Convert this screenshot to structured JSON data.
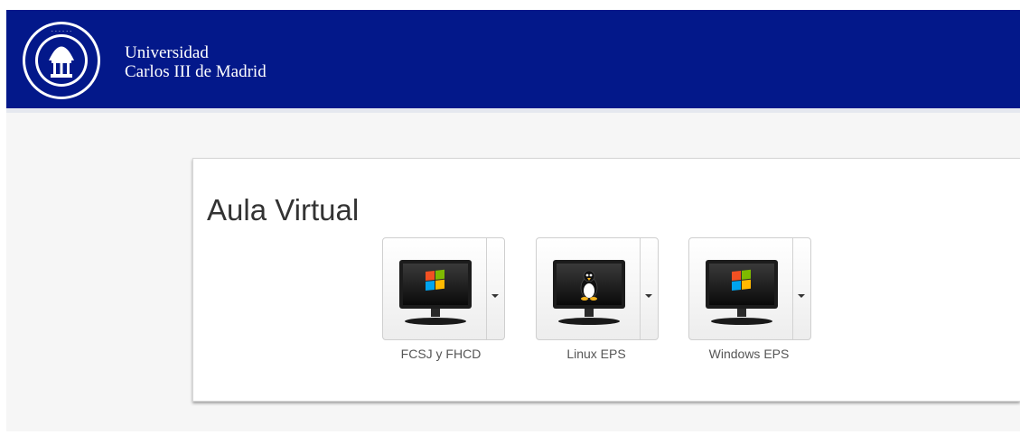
{
  "header": {
    "brand_line1": "Universidad",
    "brand_line2": "Carlos III de Madrid",
    "logo_icon": "university-seal-icon",
    "color": "#03188a"
  },
  "main": {
    "title": "Aula Virtual",
    "desktops": [
      {
        "label": "FCSJ y FHCD",
        "os_icon": "windows-logo-icon"
      },
      {
        "label": "Linux EPS",
        "os_icon": "linux-tux-icon"
      },
      {
        "label": "Windows EPS",
        "os_icon": "windows-logo-icon"
      }
    ]
  }
}
